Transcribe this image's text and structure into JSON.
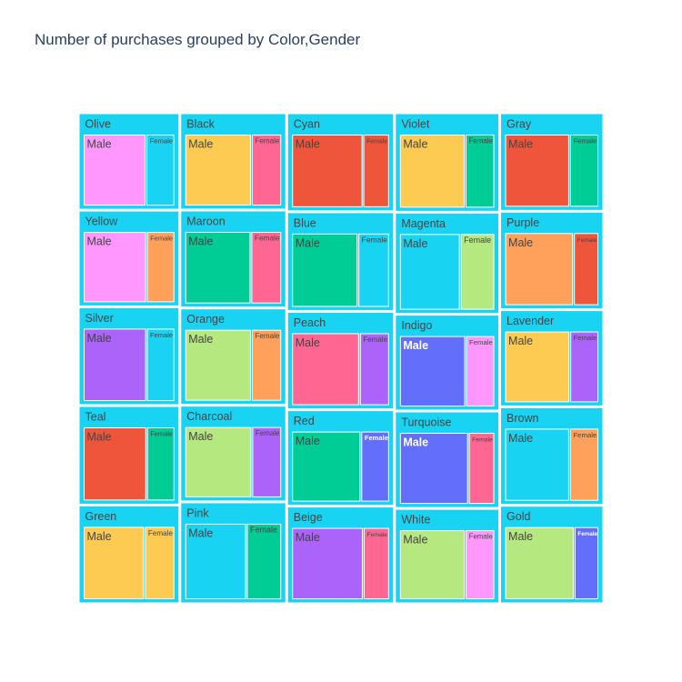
{
  "chart_data": {
    "type": "treemap",
    "title": "Number of purchases grouped by Color,Gender",
    "parent_color": "#19d3f3",
    "tile_border_color": "#ffffff",
    "dark_text_color": "#444444",
    "light_text_color": "#ffffff",
    "columns": [
      [
        {
          "name": "Olive",
          "children": [
            {
              "name": "Male",
              "value": 96,
              "color": "#ff97ff"
            },
            {
              "name": "Female",
              "value": 44,
              "color": "#19d3f3"
            }
          ]
        },
        {
          "name": "Yellow",
          "children": [
            {
              "name": "Male",
              "value": 96,
              "color": "#ff97ff"
            },
            {
              "name": "Female",
              "value": 43,
              "color": "#ffa15a"
            }
          ]
        },
        {
          "name": "Silver",
          "children": [
            {
              "name": "Male",
              "value": 98,
              "color": "#ab63fa"
            },
            {
              "name": "Female",
              "value": 44,
              "color": "#19d3f3"
            }
          ]
        },
        {
          "name": "Teal",
          "children": [
            {
              "name": "Male",
              "value": 99,
              "color": "#ef553b"
            },
            {
              "name": "Female",
              "value": 44,
              "color": "#00cc96"
            }
          ]
        },
        {
          "name": "Green",
          "children": [
            {
              "name": "Male",
              "value": 95,
              "color": "#fecb52"
            },
            {
              "name": "Female",
              "value": 47,
              "color": "#fecb52"
            }
          ]
        }
      ],
      [
        {
          "name": "Black",
          "children": [
            {
              "name": "Male",
              "value": 101,
              "color": "#fecb52"
            },
            {
              "name": "Female",
              "value": 46,
              "color": "#ff6692"
            }
          ]
        },
        {
          "name": "Maroon",
          "children": [
            {
              "name": "Male",
              "value": 101,
              "color": "#00cc96"
            },
            {
              "name": "Female",
              "value": 47,
              "color": "#ff6692"
            }
          ]
        },
        {
          "name": "Orange",
          "children": [
            {
              "name": "Male",
              "value": 101,
              "color": "#b6e880"
            },
            {
              "name": "Female",
              "value": 46,
              "color": "#ffa15a"
            }
          ]
        },
        {
          "name": "Charcoal",
          "children": [
            {
              "name": "Male",
              "value": 101,
              "color": "#b6e880"
            },
            {
              "name": "Female",
              "value": 45,
              "color": "#ab63fa"
            }
          ]
        },
        {
          "name": "Pink",
          "children": [
            {
              "name": "Male",
              "value": 98,
              "color": "#19d3f3"
            },
            {
              "name": "Female",
              "value": 56,
              "color": "#00cc96"
            }
          ]
        }
      ],
      [
        {
          "name": "Cyan",
          "children": [
            {
              "name": "Male",
              "value": 110,
              "color": "#ef553b"
            },
            {
              "name": "Female",
              "value": 41,
              "color": "#ef553b"
            }
          ]
        },
        {
          "name": "Blue",
          "children": [
            {
              "name": "Male",
              "value": 103,
              "color": "#00cc96"
            },
            {
              "name": "Female",
              "value": 49,
              "color": "#19d3f3"
            }
          ]
        },
        {
          "name": "Peach",
          "children": [
            {
              "name": "Male",
              "value": 104,
              "color": "#ff6692"
            },
            {
              "name": "Female",
              "value": 46,
              "color": "#ab63fa"
            }
          ]
        },
        {
          "name": "Red",
          "children": [
            {
              "name": "Male",
              "value": 104,
              "color": "#00cc96"
            },
            {
              "name": "Female",
              "value": 43,
              "color": "#636efa"
            }
          ]
        },
        {
          "name": "Beige",
          "children": [
            {
              "name": "Male",
              "value": 109,
              "color": "#ab63fa"
            },
            {
              "name": "Female",
              "value": 40,
              "color": "#ff6692"
            }
          ]
        }
      ],
      [
        {
          "name": "Violet",
          "children": [
            {
              "name": "Male",
              "value": 102,
              "color": "#fecb52"
            },
            {
              "name": "Female",
              "value": 46,
              "color": "#00cc96"
            }
          ]
        },
        {
          "name": "Magenta",
          "children": [
            {
              "name": "Male",
              "value": 97,
              "color": "#19d3f3"
            },
            {
              "name": "Female",
              "value": 55,
              "color": "#b6e880"
            }
          ]
        },
        {
          "name": "Indigo",
          "children": [
            {
              "name": "Male",
              "value": 100,
              "color": "#636efa"
            },
            {
              "name": "Female",
              "value": 44,
              "color": "#ff97ff"
            }
          ]
        },
        {
          "name": "Turquoise",
          "children": [
            {
              "name": "Male",
              "value": 105,
              "color": "#636efa"
            },
            {
              "name": "Female",
              "value": 40,
              "color": "#ff6692"
            }
          ]
        },
        {
          "name": "White",
          "children": [
            {
              "name": "Male",
              "value": 98,
              "color": "#b6e880"
            },
            {
              "name": "Female",
              "value": 44,
              "color": "#ff97ff"
            }
          ]
        }
      ],
      [
        {
          "name": "Gray",
          "children": [
            {
              "name": "Male",
              "value": 100,
              "color": "#ef553b"
            },
            {
              "name": "Female",
              "value": 45,
              "color": "#00cc96"
            }
          ]
        },
        {
          "name": "Purple",
          "children": [
            {
              "name": "Male",
              "value": 106,
              "color": "#ffa15a"
            },
            {
              "name": "Female",
              "value": 39,
              "color": "#ef553b"
            }
          ]
        },
        {
          "name": "Lavender",
          "children": [
            {
              "name": "Male",
              "value": 99,
              "color": "#fecb52"
            },
            {
              "name": "Female",
              "value": 44,
              "color": "#ab63fa"
            }
          ]
        },
        {
          "name": "Brown",
          "children": [
            {
              "name": "Male",
              "value": 100,
              "color": "#19d3f3"
            },
            {
              "name": "Female",
              "value": 45,
              "color": "#ffa15a"
            }
          ]
        },
        {
          "name": "Gold",
          "children": [
            {
              "name": "Male",
              "value": 107,
              "color": "#b6e880"
            },
            {
              "name": "Female",
              "value": 38,
              "color": "#636efa"
            }
          ]
        }
      ]
    ]
  }
}
